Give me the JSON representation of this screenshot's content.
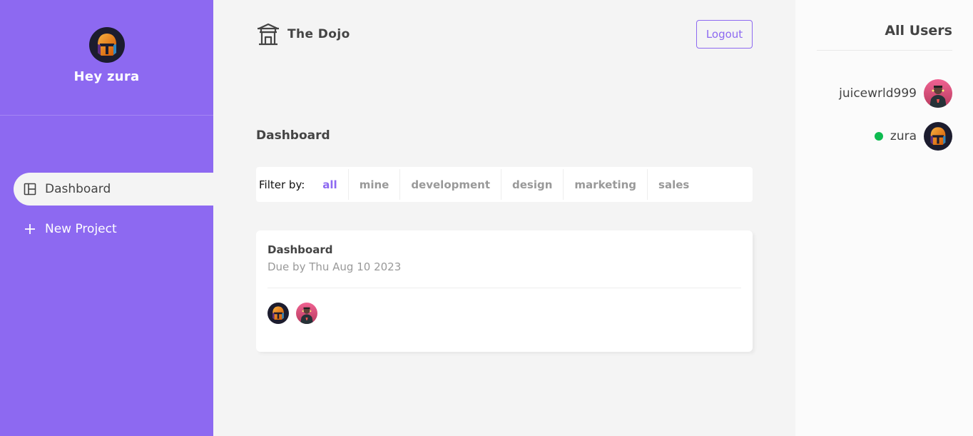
{
  "sidebar": {
    "greeting": "Hey zura",
    "avatar_icon": "knight-helmet-avatar",
    "nav": [
      {
        "label": "Dashboard",
        "icon": "dashboard-icon",
        "active": true
      },
      {
        "label": "New Project",
        "icon": "plus-icon",
        "active": false
      }
    ]
  },
  "navbar": {
    "brand_icon": "temple-icon",
    "brand_name": "The Dojo",
    "logout_label": "Logout"
  },
  "main": {
    "page_title": "Dashboard",
    "filter": {
      "label": "Filter by:",
      "options": [
        "all",
        "mine",
        "development",
        "design",
        "marketing",
        "sales"
      ],
      "active": "all"
    },
    "projects": [
      {
        "name": "Dashboard",
        "due": "Due by Thu Aug 10 2023",
        "assigned_avatars": [
          "knight-helmet-avatar",
          "rapper-avatar"
        ]
      }
    ]
  },
  "users_panel": {
    "title": "All Users",
    "users": [
      {
        "name": "juicewrld999",
        "online": false,
        "avatar": "rapper-avatar"
      },
      {
        "name": "zura",
        "online": true,
        "avatar": "knight-helmet-avatar"
      }
    ]
  },
  "colors": {
    "primary": "#8d69f1",
    "background": "#f4f4f4",
    "online": "#0ebb50",
    "text": "#444444",
    "muted": "#999999"
  }
}
